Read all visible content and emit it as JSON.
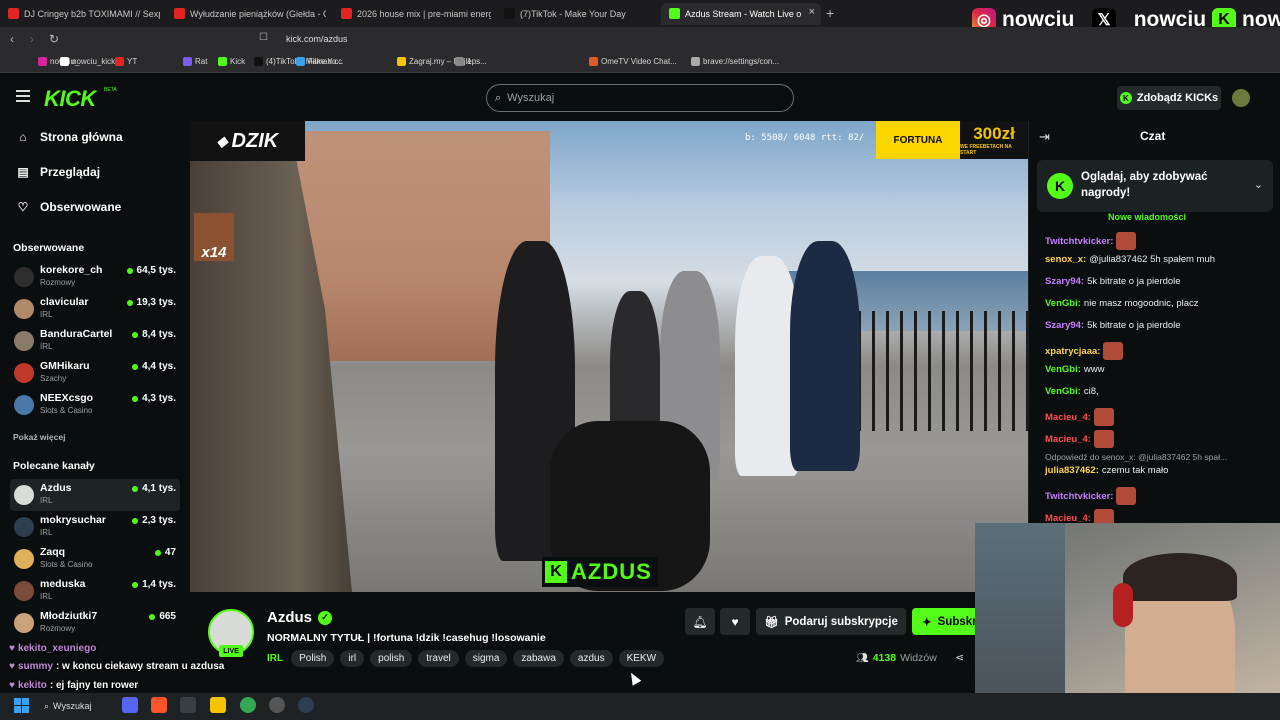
{
  "browser": {
    "tabs": [
      {
        "title": "DJ Cringey b2b TOXIMAMI // Sexpre",
        "color": "#e02424"
      },
      {
        "title": "Wyłudzanie pieniążków (Giełda - Od",
        "color": "#e02424"
      },
      {
        "title": "2026 house mix | pre-miami energy",
        "color": "#e02424"
      },
      {
        "title": "(7)TikTok - Make Your Day",
        "color": "#111111"
      },
      {
        "title": "Azdus Stream - Watch Live o",
        "color": "#53fc18"
      }
    ],
    "new_tab": "+",
    "url": "kick.com/azdus",
    "bookmarks": [
      {
        "label": "nowciu_",
        "color": "#d6249f"
      },
      {
        "label": "nowciu_kick",
        "color": "#ffffff"
      },
      {
        "label": "YT",
        "color": "#e02424"
      },
      {
        "label": "Rat",
        "color": "#7b5cff"
      },
      {
        "label": "Kick",
        "color": "#53fc18"
      },
      {
        "label": "(4)TikTok - Make Yo...",
        "color": "#111111"
      },
      {
        "label": "Filman.cc",
        "color": "#3aa0f0"
      },
      {
        "label": "Zagraj.my – Najleps...",
        "color": "#f5c400"
      },
      {
        "label": "1",
        "color": "#888888"
      },
      {
        "label": "OmeTV Video Chat...",
        "color": "#e05a2a"
      },
      {
        "label": "brave://settings/con...",
        "color": "#aaaaaa"
      }
    ]
  },
  "socials": {
    "instagram": "nowciu_",
    "x": "_nowciu",
    "kick": "nowciu"
  },
  "header": {
    "logo": "KICK",
    "beta": "BETA",
    "search_placeholder": "Wyszukaj",
    "kicks_button": "Zdobądź KICKs"
  },
  "sidebar": {
    "nav": [
      {
        "label": "Strona główna",
        "icon": "home-icon",
        "glyph": "⌂"
      },
      {
        "label": "Przeglądaj",
        "icon": "browse-icon",
        "glyph": "▤"
      },
      {
        "label": "Obserwowane",
        "icon": "heart-icon",
        "glyph": "♡"
      }
    ],
    "followed_title": "Obserwowane",
    "followed": [
      {
        "name": "korekore_ch",
        "category": "Rozmowy",
        "viewers": "64,5 tys.",
        "color": "#2d2d2d"
      },
      {
        "name": "clavicular",
        "category": "IRL",
        "viewers": "19,3 tys.",
        "color": "#b08b6a"
      },
      {
        "name": "BanduraCartel",
        "category": "IRL",
        "viewers": "8,4 tys.",
        "color": "#8a7a6a"
      },
      {
        "name": "GMHikaru",
        "category": "Szachy",
        "viewers": "4,4 tys.",
        "color": "#c0392b"
      },
      {
        "name": "NEEXcsgo",
        "category": "Slots & Casino",
        "viewers": "4,3 tys.",
        "color": "#4a78a8"
      }
    ],
    "show_more": "Pokaż więcej",
    "recommended_title": "Polecane kanały",
    "recommended": [
      {
        "name": "Azdus",
        "category": "IRL",
        "viewers": "4,1 tys.",
        "color": "#d9dcd6"
      },
      {
        "name": "mokrysuchar",
        "category": "IRL",
        "viewers": "2,3 tys.",
        "color": "#2c3e50"
      },
      {
        "name": "Zaqq",
        "category": "Slots & Casino",
        "viewers": "47",
        "color": "#e0b05a"
      },
      {
        "name": "meduska",
        "category": "IRL",
        "viewers": "1,4 tys.",
        "color": "#7a4a3a"
      },
      {
        "name": "Młodziutki7",
        "category": "Rozmowy",
        "viewers": "665",
        "color": "#c9a27a"
      }
    ]
  },
  "video": {
    "brand_left": "DZIK",
    "stats_overlay": "b: 5508/ 6048 rtt: 82/",
    "sponsor": "FORTUNA",
    "sponsor_amount": "300zł",
    "sponsor_sub": "WE FREEBETACH NA START",
    "multiplier": "x14",
    "watermark": "AZDUS"
  },
  "stream": {
    "name": "Azdus",
    "live": "LIVE",
    "title": "NORMALNY TYTUŁ | !fortuna !dzik !casehug !losowanie",
    "category": "IRL",
    "tags": [
      "Polish",
      "irl",
      "polish",
      "travel",
      "sigma",
      "zabawa",
      "azdus",
      "KEKW"
    ],
    "gift_button": "Podaruj subskrypcje",
    "subscribe_button": "Subskrybuj",
    "viewers_count": "4138",
    "viewers_label": "Widzów"
  },
  "chat": {
    "title": "Czat",
    "rewards_text": "Oglądaj, aby zdobywać nagrody!",
    "new_messages": "Nowe wiadomości",
    "messages": [
      {
        "user": "Twitchtvkicker:",
        "text": "",
        "color": "#c77dff",
        "emote": true
      },
      {
        "user": "senox_x:",
        "text": "@julia837462 5h spałem muh",
        "color": "#ffd54a",
        "emote": false
      },
      {
        "user": "Szary94:",
        "text": "5k bitrate o ja pierdole",
        "color": "#c77dff",
        "emote": false
      },
      {
        "user": "VenGbi:",
        "text": "nie masz mogoodnic, placz",
        "color": "#53fc18",
        "emote": false
      },
      {
        "user": "Szary94:",
        "text": "5k bitrate o ja pierdole",
        "color": "#c77dff",
        "emote": false
      },
      {
        "user": "xpatrycjaaa:",
        "text": "",
        "color": "#ffd54a",
        "emote": true
      },
      {
        "user": "VenGbi:",
        "text": "www",
        "color": "#53fc18",
        "emote": false
      },
      {
        "user": "VenGbi:",
        "text": "ci8,",
        "color": "#53fc18",
        "emote": false
      },
      {
        "user": "Macieu_4:",
        "text": "",
        "color": "#ff4d4d",
        "emote": true
      },
      {
        "user": "Macieu_4:",
        "text": "",
        "color": "#ff4d4d",
        "emote": true
      },
      {
        "user": "julia837462:",
        "text": "czemu tak mało",
        "color": "#ffd54a",
        "emote": false
      },
      {
        "user": "Twitchtvkicker:",
        "text": "",
        "color": "#c77dff",
        "emote": true
      },
      {
        "user": "Macieu_4:",
        "text": "",
        "color": "#ff4d4d",
        "emote": true
      }
    ],
    "reply_note": "Odpowiedź do senox_x: @julia837462 5h spał..."
  },
  "overlay_chat": [
    {
      "user": "kekito_xeuniego",
      "text": ""
    },
    {
      "user": "summy",
      "text": ": w koncu ciekawy stream u azdusa"
    },
    {
      "user": "kekito",
      "text": ": ej fajny ten rower"
    }
  ],
  "taskbar": {
    "search": "Wyszukaj"
  }
}
